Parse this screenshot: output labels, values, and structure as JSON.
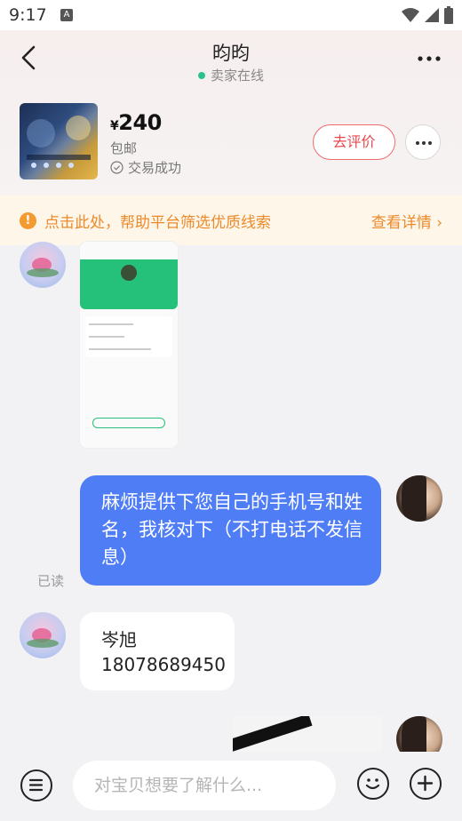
{
  "status_bar": {
    "time": "9:17",
    "notification_icon": "A"
  },
  "header": {
    "title": "昀昀",
    "online_status": "卖家在线",
    "back_icon": "chevron-left-icon",
    "more_icon": "ellipsis-icon"
  },
  "product": {
    "currency": "¥",
    "price": "240",
    "shipping": "包邮",
    "deal_status": "交易成功",
    "rate_button": "去评价"
  },
  "notice": {
    "text": "点击此处，帮助平台筛选优质线索",
    "detail_link": "查看详情 ›",
    "accent_color": "#ec8a2a"
  },
  "messages": [
    {
      "side": "left",
      "type": "image"
    },
    {
      "side": "right",
      "type": "text",
      "text": "麻烦提供下您自己的手机号和姓名，我核对下（不打电话不发信息）",
      "status": "已读"
    },
    {
      "side": "left",
      "type": "text",
      "lines": [
        "岑旭",
        "18078689450"
      ]
    },
    {
      "side": "right",
      "type": "image"
    }
  ],
  "input_bar": {
    "placeholder": "对宝贝想要了解什么...",
    "menu_icon": "list-menu-icon",
    "emoji_icon": "smiley-icon",
    "plus_icon": "plus-circle-icon"
  },
  "colors": {
    "bubble_blue": "#4f7df5",
    "accent_red": "#e8474d",
    "online_green": "#2bc18a"
  }
}
